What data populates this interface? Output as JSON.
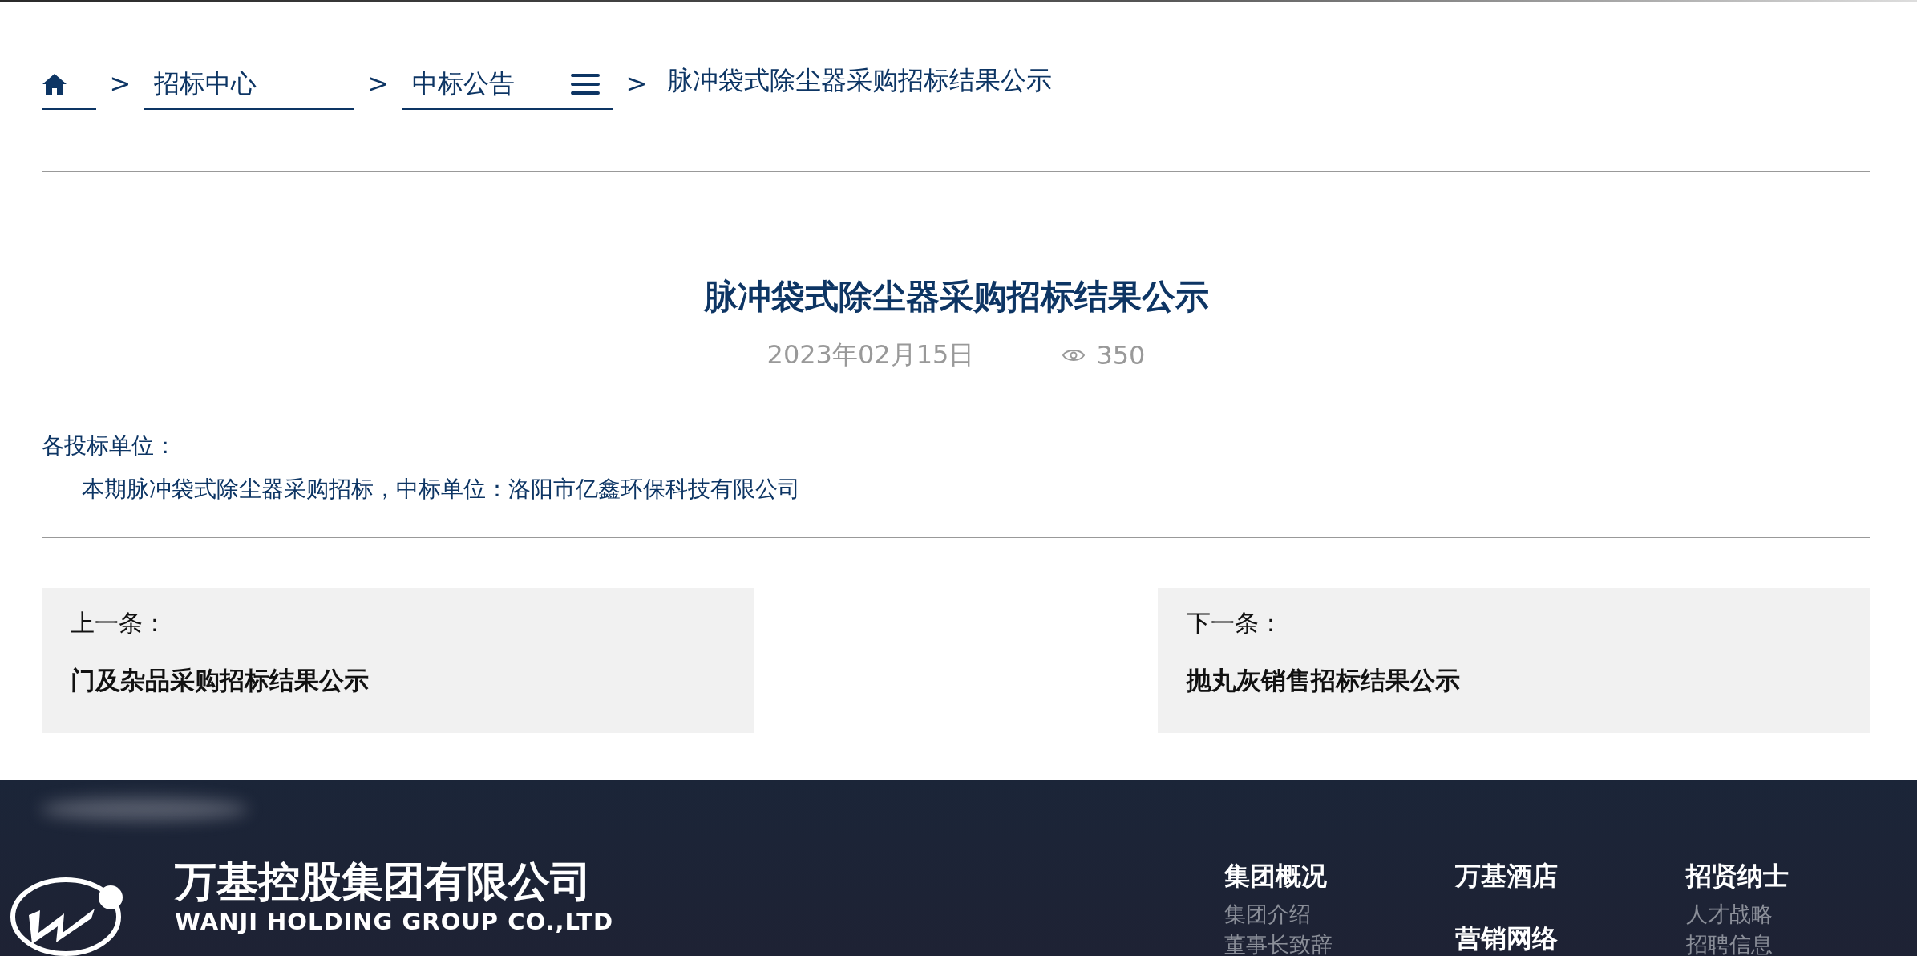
{
  "breadcrumb": {
    "items": [
      {
        "kind": "home"
      },
      {
        "kind": "link",
        "separator": ">",
        "label": "招标中心"
      },
      {
        "kind": "menu",
        "separator": ">",
        "label": "中标公告"
      },
      {
        "kind": "current",
        "separator": ">",
        "label": "脉冲袋式除尘器采购招标结果公示"
      }
    ]
  },
  "article": {
    "title": "脉冲袋式除尘器采购招标结果公示",
    "date": "2023年02月15日",
    "views": "350",
    "greeting": "各投标单位：",
    "body": "本期脉冲袋式除尘器采购招标，中标单位：洛阳市亿鑫环保科技有限公司"
  },
  "pager": [
    {
      "label": "上一条：",
      "title": "门及杂品采购招标结果公示"
    },
    {
      "label": "下一条：",
      "title": "抛丸灰销售招标结果公示"
    }
  ],
  "footer": {
    "company": "万基控股集团有限公司",
    "company_en": "WANJI HOLDING GROUP CO.,LTD",
    "columns": [
      {
        "sections": [
          {
            "heading": "集团概况",
            "links": [
              "集团介绍",
              "董事长致辞"
            ]
          }
        ]
      },
      {
        "sections": [
          {
            "heading": "万基酒店"
          },
          {
            "heading": "营销网络"
          }
        ]
      },
      {
        "sections": [
          {
            "heading": "招贤纳士",
            "links": [
              "人才战略",
              "招聘信息"
            ]
          }
        ]
      }
    ]
  }
}
